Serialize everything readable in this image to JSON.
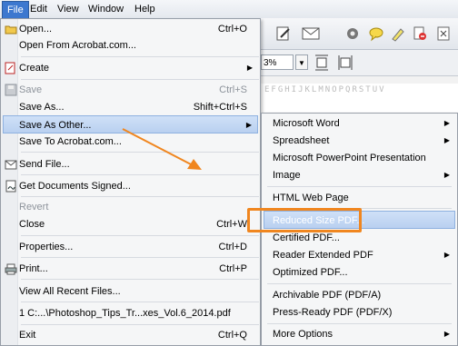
{
  "menubar": [
    "File",
    "Edit",
    "View",
    "Window",
    "Help"
  ],
  "zoom": "3%",
  "ruler": "EFGHIJKLMNOPQRSTUV",
  "file_menu": [
    {
      "label": "Open...",
      "shortcut": "Ctrl+O",
      "icon": "open-folder-icon"
    },
    {
      "label": "Open From Acrobat.com...",
      "shortcut": ""
    },
    {
      "label": "Create",
      "shortcut": "",
      "submenu": true,
      "icon": "create-pdf-icon"
    },
    {
      "label": "Save",
      "shortcut": "Ctrl+S",
      "disabled": true,
      "icon": "save-icon"
    },
    {
      "label": "Save As...",
      "shortcut": "Shift+Ctrl+S"
    },
    {
      "label": "Save As Other...",
      "shortcut": "",
      "submenu": true,
      "highlighted": true
    },
    {
      "label": "Save To Acrobat.com...",
      "shortcut": ""
    },
    {
      "label": "Send File...",
      "shortcut": "",
      "icon": "envelope-icon"
    },
    {
      "label": "Get Documents Signed...",
      "shortcut": "",
      "icon": "sign-icon"
    },
    {
      "label": "Revert",
      "shortcut": "",
      "disabled": true
    },
    {
      "label": "Close",
      "shortcut": "Ctrl+W"
    },
    {
      "label": "Properties...",
      "shortcut": "Ctrl+D"
    },
    {
      "label": "Print...",
      "shortcut": "Ctrl+P",
      "icon": "printer-icon"
    },
    {
      "label": "View All Recent Files...",
      "shortcut": ""
    },
    {
      "label": "1 C:...\\Photoshop_Tips_Tr...xes_Vol.6_2014.pdf",
      "shortcut": ""
    },
    {
      "label": "Exit",
      "shortcut": "Ctrl+Q"
    }
  ],
  "save_as_other_menu": [
    {
      "label": "Microsoft Word",
      "submenu": true
    },
    {
      "label": "Spreadsheet",
      "submenu": true
    },
    {
      "label": "Microsoft PowerPoint Presentation"
    },
    {
      "label": "Image",
      "submenu": true
    },
    {
      "label": "HTML Web Page"
    },
    {
      "label": "Reduced Size PDF...",
      "highlighted": true
    },
    {
      "label": "Certified PDF..."
    },
    {
      "label": "Reader Extended PDF",
      "submenu": true
    },
    {
      "label": "Optimized PDF..."
    },
    {
      "label": "Archivable PDF (PDF/A)"
    },
    {
      "label": "Press-Ready PDF (PDF/X)"
    },
    {
      "label": "More Options",
      "submenu": true
    }
  ],
  "colors": {
    "annotation": "#f0861f",
    "highlight": "#b9d0f0",
    "menubar_active": "#3d78cf"
  }
}
